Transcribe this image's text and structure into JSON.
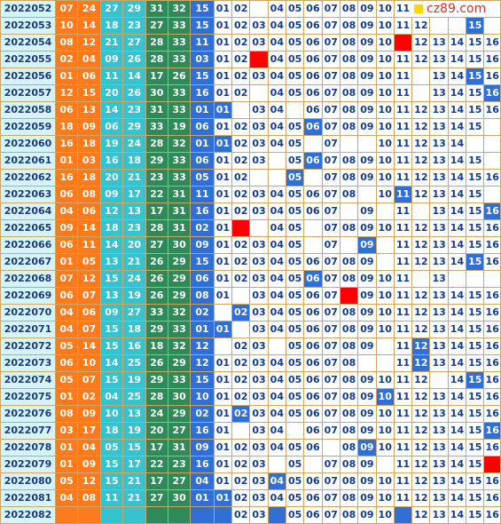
{
  "watermark": "cz89.com",
  "rows": [
    {
      "issue": "2022052",
      "reds": [
        "07",
        "24",
        "27",
        "29",
        "31",
        "32"
      ],
      "blue": "15",
      "dist": [
        "01",
        "02",
        "",
        "04",
        "05",
        "06",
        "07",
        "08",
        "09",
        "10",
        "11",
        "",
        "",
        "",
        "",
        ""
      ],
      "special": {}
    },
    {
      "issue": "2022053",
      "reds": [
        "10",
        "14",
        "18",
        "23",
        "27",
        "33"
      ],
      "blue": "15",
      "dist": [
        "01",
        "02",
        "03",
        "04",
        "05",
        "06",
        "07",
        "08",
        "09",
        "10",
        "11",
        "12",
        "",
        "",
        "15",
        ""
      ],
      "special": {
        "15": "hit"
      }
    },
    {
      "issue": "2022054",
      "reds": [
        "08",
        "12",
        "21",
        "27",
        "28",
        "33"
      ],
      "blue": "11",
      "dist": [
        "01",
        "02",
        "03",
        "04",
        "05",
        "06",
        "07",
        "08",
        "09",
        "10",
        "",
        "12",
        "13",
        "14",
        "15",
        "16"
      ],
      "special": {
        "11": "mark"
      }
    },
    {
      "issue": "2022055",
      "reds": [
        "02",
        "04",
        "09",
        "26",
        "28",
        "33"
      ],
      "blue": "03",
      "dist": [
        "01",
        "02",
        "",
        "04",
        "05",
        "06",
        "07",
        "08",
        "09",
        "10",
        "11",
        "12",
        "13",
        "14",
        "15",
        "16"
      ],
      "special": {
        "03": "mark"
      }
    },
    {
      "issue": "2022056",
      "reds": [
        "01",
        "06",
        "11",
        "14",
        "17",
        "26"
      ],
      "blue": "15",
      "dist": [
        "01",
        "02",
        "03",
        "04",
        "05",
        "06",
        "07",
        "08",
        "09",
        "10",
        "11",
        "",
        "13",
        "14",
        "15",
        "16"
      ],
      "special": {
        "15": "hit"
      }
    },
    {
      "issue": "2022057",
      "reds": [
        "12",
        "15",
        "20",
        "26",
        "30",
        "33"
      ],
      "blue": "16",
      "dist": [
        "01",
        "02",
        "",
        "04",
        "05",
        "06",
        "07",
        "08",
        "09",
        "10",
        "11",
        "",
        "13",
        "14",
        "15",
        "16"
      ],
      "special": {
        "16": "hit"
      }
    },
    {
      "issue": "2022058",
      "reds": [
        "06",
        "13",
        "14",
        "23",
        "31",
        "33"
      ],
      "blue": "01",
      "dist": [
        "01",
        "",
        "03",
        "04",
        "",
        "06",
        "07",
        "08",
        "09",
        "10",
        "11",
        "12",
        "13",
        "14",
        "15",
        "16"
      ],
      "special": {
        "01": "hit"
      }
    },
    {
      "issue": "2022059",
      "reds": [
        "18",
        "09",
        "06",
        "29",
        "33",
        "19"
      ],
      "blue": "06",
      "dist": [
        "01",
        "02",
        "03",
        "04",
        "05",
        "06",
        "07",
        "08",
        "09",
        "10",
        "11",
        "12",
        "13",
        "14",
        "15",
        ""
      ],
      "special": {
        "06": "hit"
      }
    },
    {
      "issue": "2022060",
      "reds": [
        "16",
        "18",
        "19",
        "24",
        "28",
        "32"
      ],
      "blue": "01",
      "dist": [
        "01",
        "02",
        "03",
        "04",
        "05",
        "",
        "07",
        "",
        "",
        "10",
        "11",
        "12",
        "13",
        "14",
        "",
        ""
      ],
      "special": {
        "01": "hit"
      }
    },
    {
      "issue": "2022061",
      "reds": [
        "01",
        "03",
        "16",
        "18",
        "29",
        "33"
      ],
      "blue": "06",
      "dist": [
        "01",
        "02",
        "03",
        "",
        "05",
        "06",
        "07",
        "08",
        "09",
        "10",
        "11",
        "12",
        "13",
        "14",
        "15",
        ""
      ],
      "special": {
        "06": "hit"
      }
    },
    {
      "issue": "2022062",
      "reds": [
        "16",
        "18",
        "20",
        "21",
        "23",
        "33"
      ],
      "blue": "05",
      "dist": [
        "01",
        "02",
        "",
        "",
        "05",
        "",
        "07",
        "08",
        "09",
        "10",
        "11",
        "12",
        "13",
        "14",
        "15",
        "16"
      ],
      "special": {
        "05": "hit"
      }
    },
    {
      "issue": "2022063",
      "reds": [
        "06",
        "08",
        "09",
        "17",
        "22",
        "31"
      ],
      "blue": "11",
      "dist": [
        "01",
        "02",
        "03",
        "04",
        "05",
        "06",
        "07",
        "08",
        "",
        "10",
        "11",
        "12",
        "13",
        "14",
        "15",
        ""
      ],
      "special": {
        "11": "hit"
      }
    },
    {
      "issue": "2022064",
      "reds": [
        "04",
        "06",
        "12",
        "13",
        "17",
        "31"
      ],
      "blue": "16",
      "dist": [
        "01",
        "02",
        "03",
        "04",
        "05",
        "06",
        "07",
        "",
        "09",
        "",
        "11",
        "",
        "13",
        "14",
        "15",
        "16"
      ],
      "special": {
        "16": "hit"
      }
    },
    {
      "issue": "2022065",
      "reds": [
        "09",
        "14",
        "18",
        "23",
        "28",
        "31"
      ],
      "blue": "02",
      "dist": [
        "01",
        "",
        "",
        "04",
        "05",
        "",
        "07",
        "08",
        "09",
        "10",
        "11",
        "12",
        "13",
        "14",
        "15",
        "16"
      ],
      "special": {
        "02": "mark"
      }
    },
    {
      "issue": "2022066",
      "reds": [
        "06",
        "11",
        "14",
        "20",
        "27",
        "30"
      ],
      "blue": "09",
      "dist": [
        "01",
        "02",
        "03",
        "04",
        "05",
        "",
        "07",
        "",
        "09",
        "",
        "11",
        "12",
        "13",
        "14",
        "15",
        "16"
      ],
      "special": {
        "09": "hit"
      }
    },
    {
      "issue": "2022067",
      "reds": [
        "01",
        "05",
        "13",
        "21",
        "26",
        "29"
      ],
      "blue": "15",
      "dist": [
        "01",
        "02",
        "03",
        "04",
        "05",
        "06",
        "07",
        "08",
        "09",
        "",
        "11",
        "12",
        "13",
        "14",
        "15",
        "16"
      ],
      "special": {
        "15": "hit"
      }
    },
    {
      "issue": "2022068",
      "reds": [
        "07",
        "12",
        "15",
        "24",
        "26",
        "29"
      ],
      "blue": "06",
      "dist": [
        "01",
        "02",
        "03",
        "04",
        "05",
        "06",
        "07",
        "08",
        "09",
        "10",
        "11",
        "",
        "13",
        "",
        "",
        ""
      ],
      "special": {
        "06": "hit"
      }
    },
    {
      "issue": "2022069",
      "reds": [
        "06",
        "07",
        "13",
        "19",
        "26",
        "29"
      ],
      "blue": "08",
      "dist": [
        "01",
        "",
        "03",
        "04",
        "05",
        "06",
        "07",
        "08",
        "09",
        "10",
        "11",
        "12",
        "13",
        "14",
        "15",
        "16"
      ],
      "special": {
        "08": "mark"
      }
    },
    {
      "issue": "2022070",
      "reds": [
        "04",
        "06",
        "09",
        "27",
        "33",
        "32"
      ],
      "blue": "02",
      "dist": [
        "",
        "02",
        "03",
        "04",
        "05",
        "06",
        "07",
        "08",
        "09",
        "10",
        "11",
        "12",
        "13",
        "14",
        "15",
        "16"
      ],
      "special": {
        "02": "hit"
      }
    },
    {
      "issue": "2022071",
      "reds": [
        "04",
        "07",
        "15",
        "18",
        "29",
        "33"
      ],
      "blue": "01",
      "dist": [
        "01",
        "",
        "03",
        "04",
        "05",
        "06",
        "07",
        "08",
        "09",
        "10",
        "11",
        "12",
        "13",
        "14",
        "15",
        "16"
      ],
      "special": {
        "01": "hit"
      }
    },
    {
      "issue": "2022072",
      "reds": [
        "05",
        "14",
        "15",
        "16",
        "18",
        "32"
      ],
      "blue": "12",
      "dist": [
        "",
        "02",
        "03",
        "",
        "05",
        "06",
        "07",
        "08",
        "09",
        "",
        "11",
        "12",
        "13",
        "14",
        "15",
        "16"
      ],
      "special": {
        "12": "hit"
      }
    },
    {
      "issue": "2022073",
      "reds": [
        "06",
        "10",
        "14",
        "25",
        "26",
        "29"
      ],
      "blue": "12",
      "dist": [
        "01",
        "02",
        "03",
        "04",
        "05",
        "06",
        "07",
        "08",
        "",
        "",
        "11",
        "12",
        "13",
        "14",
        "15",
        "16"
      ],
      "special": {
        "12": "hit"
      }
    },
    {
      "issue": "2022074",
      "reds": [
        "05",
        "07",
        "15",
        "19",
        "29",
        "33"
      ],
      "blue": "15",
      "dist": [
        "01",
        "02",
        "03",
        "04",
        "05",
        "06",
        "07",
        "08",
        "09",
        "10",
        "11",
        "12",
        "",
        "14",
        "15",
        "16"
      ],
      "special": {
        "15": "hit"
      }
    },
    {
      "issue": "2022075",
      "reds": [
        "01",
        "02",
        "04",
        "25",
        "28",
        "30"
      ],
      "blue": "10",
      "dist": [
        "01",
        "02",
        "03",
        "04",
        "05",
        "06",
        "07",
        "08",
        "09",
        "10",
        "11",
        "12",
        "13",
        "14",
        "15",
        "16"
      ],
      "special": {
        "10": "hit"
      }
    },
    {
      "issue": "2022076",
      "reds": [
        "08",
        "09",
        "10",
        "13",
        "24",
        "29"
      ],
      "blue": "02",
      "dist": [
        "01",
        "02",
        "03",
        "04",
        "05",
        "06",
        "07",
        "08",
        "09",
        "10",
        "11",
        "12",
        "13",
        "14",
        "15",
        "16"
      ],
      "special": {
        "02": "hit"
      }
    },
    {
      "issue": "2022077",
      "reds": [
        "03",
        "17",
        "18",
        "19",
        "20",
        "27"
      ],
      "blue": "16",
      "dist": [
        "01",
        "",
        "03",
        "04",
        "",
        "06",
        "07",
        "08",
        "09",
        "10",
        "11",
        "12",
        "13",
        "14",
        "15",
        "16"
      ],
      "special": {
        "16": "hit"
      }
    },
    {
      "issue": "2022078",
      "reds": [
        "01",
        "04",
        "05",
        "15",
        "17",
        "31"
      ],
      "blue": "09",
      "dist": [
        "01",
        "02",
        "03",
        "04",
        "05",
        "06",
        "",
        "08",
        "09",
        "10",
        "11",
        "12",
        "13",
        "14",
        "15",
        "16"
      ],
      "special": {
        "09": "hit"
      }
    },
    {
      "issue": "2022079",
      "reds": [
        "01",
        "09",
        "15",
        "17",
        "22",
        "23"
      ],
      "blue": "16",
      "dist": [
        "01",
        "02",
        "03",
        "",
        "05",
        "",
        "07",
        "08",
        "09",
        "",
        "11",
        "12",
        "13",
        "14",
        "15",
        "16"
      ],
      "special": {
        "16": "mark"
      }
    },
    {
      "issue": "2022080",
      "reds": [
        "05",
        "12",
        "15",
        "21",
        "17",
        "27"
      ],
      "blue": "04",
      "dist": [
        "01",
        "02",
        "03",
        "04",
        "05",
        "06",
        "07",
        "08",
        "09",
        "10",
        "11",
        "12",
        "13",
        "14",
        "15",
        "16"
      ],
      "special": {
        "04": "hit"
      }
    },
    {
      "issue": "2022081",
      "reds": [
        "04",
        "08",
        "11",
        "21",
        "27",
        "30"
      ],
      "blue": "01",
      "dist": [
        "01",
        "02",
        "03",
        "04",
        "05",
        "06",
        "07",
        "08",
        "09",
        "10",
        "11",
        "12",
        "13",
        "14",
        "15",
        "16"
      ],
      "special": {
        "01": "hit"
      }
    },
    {
      "issue": "2022082",
      "reds": [
        "",
        "",
        "",
        "",
        "",
        ""
      ],
      "blue": "",
      "dist": [
        "",
        "02",
        "03",
        "",
        "05",
        "06",
        "07",
        "08",
        "09",
        "10",
        "",
        "12",
        "13",
        "14",
        "15",
        "16"
      ],
      "special": {
        "01": "markb",
        "04": "markb",
        "11": "markb"
      }
    }
  ]
}
